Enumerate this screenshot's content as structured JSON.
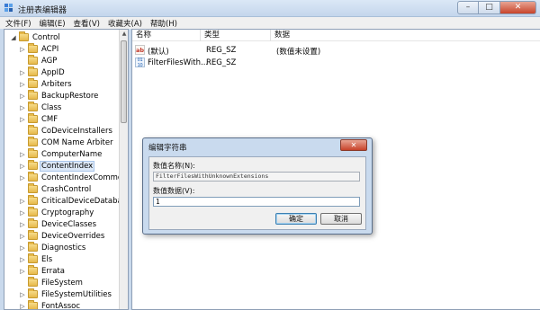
{
  "window": {
    "title": "注册表编辑器",
    "minimize_glyph": "–",
    "maximize_glyph": "□",
    "close_glyph": "✕"
  },
  "menu": [
    "文件(F)",
    "编辑(E)",
    "查看(V)",
    "收藏夹(A)",
    "帮助(H)"
  ],
  "tree": {
    "root": "Control",
    "items": [
      {
        "label": "ACPI",
        "expandable": true
      },
      {
        "label": "AGP",
        "expandable": false
      },
      {
        "label": "AppID",
        "expandable": true
      },
      {
        "label": "Arbiters",
        "expandable": true
      },
      {
        "label": "BackupRestore",
        "expandable": true
      },
      {
        "label": "Class",
        "expandable": true
      },
      {
        "label": "CMF",
        "expandable": true
      },
      {
        "label": "CoDeviceInstallers",
        "expandable": false
      },
      {
        "label": "COM Name Arbiter",
        "expandable": false
      },
      {
        "label": "ComputerName",
        "expandable": true
      },
      {
        "label": "ContentIndex",
        "expandable": true,
        "selected": true
      },
      {
        "label": "ContentIndexCommon",
        "expandable": true
      },
      {
        "label": "CrashControl",
        "expandable": false
      },
      {
        "label": "CriticalDeviceDatabase",
        "expandable": true
      },
      {
        "label": "Cryptography",
        "expandable": true
      },
      {
        "label": "DeviceClasses",
        "expandable": true
      },
      {
        "label": "DeviceOverrides",
        "expandable": true
      },
      {
        "label": "Diagnostics",
        "expandable": true
      },
      {
        "label": "Els",
        "expandable": true
      },
      {
        "label": "Errata",
        "expandable": true
      },
      {
        "label": "FileSystem",
        "expandable": false
      },
      {
        "label": "FileSystemUtilities",
        "expandable": true
      },
      {
        "label": "FontAssoc",
        "expandable": true
      }
    ]
  },
  "values": {
    "columns": {
      "name": "名称",
      "type": "类型",
      "data": "数据"
    },
    "rows": [
      {
        "icon": "string-value-icon",
        "name": "(默认)",
        "type": "REG_SZ",
        "data": "(数值未设置)"
      },
      {
        "icon": "string-value-icon",
        "name": "FilterFilesWith...",
        "type": "REG_SZ",
        "data": ""
      }
    ]
  },
  "dialog": {
    "title": "编辑字符串",
    "close_glyph": "✕",
    "name_label": "数值名称(N):",
    "name_value": "FilterFilesWithUnknownExtensions",
    "data_label": "数值数据(V):",
    "data_value": "1",
    "ok_label": "确定",
    "cancel_label": "取消"
  },
  "icons": {
    "folder": "folder-icon",
    "app": "registry-editor-icon",
    "string_value": "ab-icon",
    "binary_value": "binary-value-icon"
  },
  "colors": {
    "title_gradient_top": "#dbe8f6",
    "selection": "#dce8f7",
    "folder": "#e6b94a",
    "close_button": "#c7432a"
  }
}
